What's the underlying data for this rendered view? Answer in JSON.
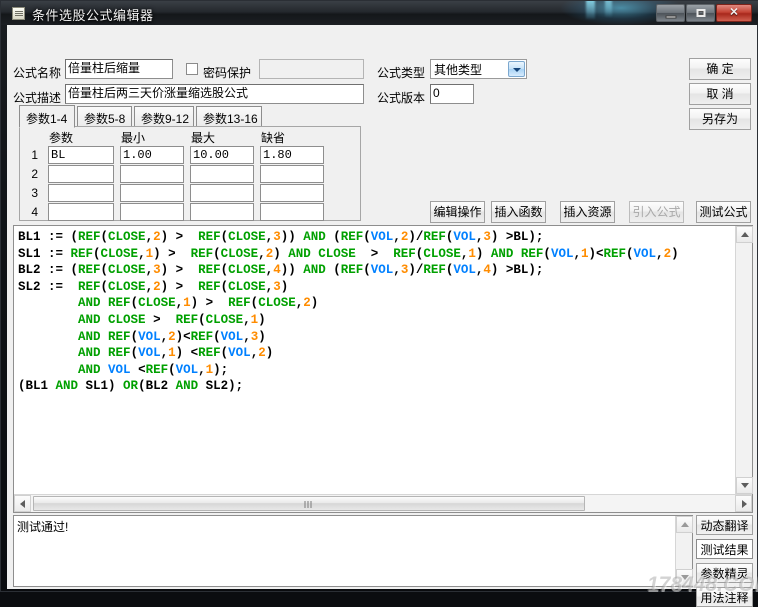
{
  "window": {
    "title": "条件选股公式编辑器",
    "icon": "document-icon",
    "buttons": {
      "minimize": "minimize-icon",
      "maximize": "maximize-icon",
      "close": "✕"
    }
  },
  "form": {
    "name_label": "公式名称",
    "name_value": "倍量柱后缩量",
    "password_label": "密码保护",
    "password_value": "",
    "password_checked": false,
    "desc_label": "公式描述",
    "desc_value": "倍量柱后两三天价涨量缩选股公式",
    "type_label": "公式类型",
    "type_value": "其他类型",
    "version_label": "公式版本",
    "version_value": "0"
  },
  "commands": {
    "ok": "确  定",
    "cancel": "取  消",
    "save_as": "另存为"
  },
  "tabs": [
    {
      "label": "参数1-4",
      "active": true
    },
    {
      "label": "参数5-8",
      "active": false
    },
    {
      "label": "参数9-12",
      "active": false
    },
    {
      "label": "参数13-16",
      "active": false
    }
  ],
  "params": {
    "headers": [
      "参数",
      "最小",
      "最大",
      "缺省"
    ],
    "rows": [
      {
        "num": "1",
        "name": "BL",
        "min": "1.00",
        "max": "10.00",
        "default": "1.80"
      },
      {
        "num": "2",
        "name": "",
        "min": "",
        "max": "",
        "default": ""
      },
      {
        "num": "3",
        "name": "",
        "min": "",
        "max": "",
        "default": ""
      },
      {
        "num": "4",
        "name": "",
        "min": "",
        "max": "",
        "default": ""
      }
    ]
  },
  "editor_toolbar": [
    {
      "label": "编辑操作",
      "enabled": true
    },
    {
      "label": "插入函数",
      "enabled": true
    },
    {
      "label": "插入资源",
      "enabled": true
    },
    {
      "label": "引入公式",
      "enabled": false
    },
    {
      "label": "测试公式",
      "enabled": true
    }
  ],
  "code": {
    "colors": {
      "function": "#00a000",
      "number": "#ff8c00",
      "variable": "#0080ff",
      "plain": "#000000"
    },
    "lines": [
      [
        {
          "t": "BL1 := (",
          "c": "p"
        },
        {
          "t": "REF",
          "c": "k"
        },
        {
          "t": "(",
          "c": "p"
        },
        {
          "t": "CLOSE",
          "c": "k"
        },
        {
          "t": ",",
          "c": "p"
        },
        {
          "t": "2",
          "c": "n"
        },
        {
          "t": ") > ",
          "c": "p"
        },
        {
          "t": " ",
          "c": "p"
        },
        {
          "t": "REF",
          "c": "k"
        },
        {
          "t": "(",
          "c": "p"
        },
        {
          "t": "CLOSE",
          "c": "k"
        },
        {
          "t": ",",
          "c": "p"
        },
        {
          "t": "3",
          "c": "n"
        },
        {
          "t": ")) ",
          "c": "p"
        },
        {
          "t": "AND",
          "c": "k"
        },
        {
          "t": " (",
          "c": "p"
        },
        {
          "t": "REF",
          "c": "k"
        },
        {
          "t": "(",
          "c": "p"
        },
        {
          "t": "VOL",
          "c": "v"
        },
        {
          "t": ",",
          "c": "p"
        },
        {
          "t": "2",
          "c": "n"
        },
        {
          "t": ")/",
          "c": "p"
        },
        {
          "t": "REF",
          "c": "k"
        },
        {
          "t": "(",
          "c": "p"
        },
        {
          "t": "VOL",
          "c": "v"
        },
        {
          "t": ",",
          "c": "p"
        },
        {
          "t": "3",
          "c": "n"
        },
        {
          "t": ") >BL);",
          "c": "p"
        }
      ],
      [
        {
          "t": "SL1 := ",
          "c": "p"
        },
        {
          "t": "REF",
          "c": "k"
        },
        {
          "t": "(",
          "c": "p"
        },
        {
          "t": "CLOSE",
          "c": "k"
        },
        {
          "t": ",",
          "c": "p"
        },
        {
          "t": "1",
          "c": "n"
        },
        {
          "t": ") > ",
          "c": "p"
        },
        {
          "t": " ",
          "c": "p"
        },
        {
          "t": "REF",
          "c": "k"
        },
        {
          "t": "(",
          "c": "p"
        },
        {
          "t": "CLOSE",
          "c": "k"
        },
        {
          "t": ",",
          "c": "p"
        },
        {
          "t": "2",
          "c": "n"
        },
        {
          "t": ") ",
          "c": "p"
        },
        {
          "t": "AND",
          "c": "k"
        },
        {
          "t": " ",
          "c": "p"
        },
        {
          "t": "CLOSE",
          "c": "k"
        },
        {
          "t": "  >  ",
          "c": "p"
        },
        {
          "t": "REF",
          "c": "k"
        },
        {
          "t": "(",
          "c": "p"
        },
        {
          "t": "CLOSE",
          "c": "k"
        },
        {
          "t": ",",
          "c": "p"
        },
        {
          "t": "1",
          "c": "n"
        },
        {
          "t": ") ",
          "c": "p"
        },
        {
          "t": "AND",
          "c": "k"
        },
        {
          "t": " ",
          "c": "p"
        },
        {
          "t": "REF",
          "c": "k"
        },
        {
          "t": "(",
          "c": "p"
        },
        {
          "t": "VOL",
          "c": "v"
        },
        {
          "t": ",",
          "c": "p"
        },
        {
          "t": "1",
          "c": "n"
        },
        {
          "t": ")<",
          "c": "p"
        },
        {
          "t": "REF",
          "c": "k"
        },
        {
          "t": "(",
          "c": "p"
        },
        {
          "t": "VOL",
          "c": "v"
        },
        {
          "t": ",",
          "c": "p"
        },
        {
          "t": "2",
          "c": "n"
        },
        {
          "t": ")",
          "c": "p"
        }
      ],
      [
        {
          "t": "BL2 := (",
          "c": "p"
        },
        {
          "t": "REF",
          "c": "k"
        },
        {
          "t": "(",
          "c": "p"
        },
        {
          "t": "CLOSE",
          "c": "k"
        },
        {
          "t": ",",
          "c": "p"
        },
        {
          "t": "3",
          "c": "n"
        },
        {
          "t": ") > ",
          "c": "p"
        },
        {
          "t": " ",
          "c": "p"
        },
        {
          "t": "REF",
          "c": "k"
        },
        {
          "t": "(",
          "c": "p"
        },
        {
          "t": "CLOSE",
          "c": "k"
        },
        {
          "t": ",",
          "c": "p"
        },
        {
          "t": "4",
          "c": "n"
        },
        {
          "t": ")) ",
          "c": "p"
        },
        {
          "t": "AND",
          "c": "k"
        },
        {
          "t": " (",
          "c": "p"
        },
        {
          "t": "REF",
          "c": "k"
        },
        {
          "t": "(",
          "c": "p"
        },
        {
          "t": "VOL",
          "c": "v"
        },
        {
          "t": ",",
          "c": "p"
        },
        {
          "t": "3",
          "c": "n"
        },
        {
          "t": ")/",
          "c": "p"
        },
        {
          "t": "REF",
          "c": "k"
        },
        {
          "t": "(",
          "c": "p"
        },
        {
          "t": "VOL",
          "c": "v"
        },
        {
          "t": ",",
          "c": "p"
        },
        {
          "t": "4",
          "c": "n"
        },
        {
          "t": ") >BL);",
          "c": "p"
        }
      ],
      [
        {
          "t": "SL2 :=  ",
          "c": "p"
        },
        {
          "t": "REF",
          "c": "k"
        },
        {
          "t": "(",
          "c": "p"
        },
        {
          "t": "CLOSE",
          "c": "k"
        },
        {
          "t": ",",
          "c": "p"
        },
        {
          "t": "2",
          "c": "n"
        },
        {
          "t": ") > ",
          "c": "p"
        },
        {
          "t": " ",
          "c": "p"
        },
        {
          "t": "REF",
          "c": "k"
        },
        {
          "t": "(",
          "c": "p"
        },
        {
          "t": "CLOSE",
          "c": "k"
        },
        {
          "t": ",",
          "c": "p"
        },
        {
          "t": "3",
          "c": "n"
        },
        {
          "t": ")",
          "c": "p"
        }
      ],
      [
        {
          "t": "        ",
          "c": "p"
        },
        {
          "t": "AND",
          "c": "k"
        },
        {
          "t": " ",
          "c": "p"
        },
        {
          "t": "REF",
          "c": "k"
        },
        {
          "t": "(",
          "c": "p"
        },
        {
          "t": "CLOSE",
          "c": "k"
        },
        {
          "t": ",",
          "c": "p"
        },
        {
          "t": "1",
          "c": "n"
        },
        {
          "t": ") > ",
          "c": "p"
        },
        {
          "t": " ",
          "c": "p"
        },
        {
          "t": "REF",
          "c": "k"
        },
        {
          "t": "(",
          "c": "p"
        },
        {
          "t": "CLOSE",
          "c": "k"
        },
        {
          "t": ",",
          "c": "p"
        },
        {
          "t": "2",
          "c": "n"
        },
        {
          "t": ")",
          "c": "p"
        }
      ],
      [
        {
          "t": "        ",
          "c": "p"
        },
        {
          "t": "AND",
          "c": "k"
        },
        {
          "t": " ",
          "c": "p"
        },
        {
          "t": "CLOSE",
          "c": "k"
        },
        {
          "t": " > ",
          "c": "p"
        },
        {
          "t": " ",
          "c": "p"
        },
        {
          "t": "REF",
          "c": "k"
        },
        {
          "t": "(",
          "c": "p"
        },
        {
          "t": "CLOSE",
          "c": "k"
        },
        {
          "t": ",",
          "c": "p"
        },
        {
          "t": "1",
          "c": "n"
        },
        {
          "t": ")",
          "c": "p"
        }
      ],
      [
        {
          "t": "        ",
          "c": "p"
        },
        {
          "t": "AND",
          "c": "k"
        },
        {
          "t": " ",
          "c": "p"
        },
        {
          "t": "REF",
          "c": "k"
        },
        {
          "t": "(",
          "c": "p"
        },
        {
          "t": "VOL",
          "c": "v"
        },
        {
          "t": ",",
          "c": "p"
        },
        {
          "t": "2",
          "c": "n"
        },
        {
          "t": ")<",
          "c": "p"
        },
        {
          "t": "REF",
          "c": "k"
        },
        {
          "t": "(",
          "c": "p"
        },
        {
          "t": "VOL",
          "c": "v"
        },
        {
          "t": ",",
          "c": "p"
        },
        {
          "t": "3",
          "c": "n"
        },
        {
          "t": ")",
          "c": "p"
        }
      ],
      [
        {
          "t": "        ",
          "c": "p"
        },
        {
          "t": "AND",
          "c": "k"
        },
        {
          "t": " ",
          "c": "p"
        },
        {
          "t": "REF",
          "c": "k"
        },
        {
          "t": "(",
          "c": "p"
        },
        {
          "t": "VOL",
          "c": "v"
        },
        {
          "t": ",",
          "c": "p"
        },
        {
          "t": "1",
          "c": "n"
        },
        {
          "t": ") <",
          "c": "p"
        },
        {
          "t": "REF",
          "c": "k"
        },
        {
          "t": "(",
          "c": "p"
        },
        {
          "t": "VOL",
          "c": "v"
        },
        {
          "t": ",",
          "c": "p"
        },
        {
          "t": "2",
          "c": "n"
        },
        {
          "t": ")",
          "c": "p"
        }
      ],
      [
        {
          "t": "        ",
          "c": "p"
        },
        {
          "t": "AND",
          "c": "k"
        },
        {
          "t": " ",
          "c": "p"
        },
        {
          "t": "VOL",
          "c": "v"
        },
        {
          "t": " <",
          "c": "p"
        },
        {
          "t": "REF",
          "c": "k"
        },
        {
          "t": "(",
          "c": "p"
        },
        {
          "t": "VOL",
          "c": "v"
        },
        {
          "t": ",",
          "c": "p"
        },
        {
          "t": "1",
          "c": "n"
        },
        {
          "t": ");",
          "c": "p"
        }
      ],
      [
        {
          "t": "(BL1 ",
          "c": "p"
        },
        {
          "t": "AND",
          "c": "k"
        },
        {
          "t": " SL1) ",
          "c": "p"
        },
        {
          "t": "OR",
          "c": "k"
        },
        {
          "t": "(BL2 ",
          "c": "p"
        },
        {
          "t": "AND",
          "c": "k"
        },
        {
          "t": " SL2);",
          "c": "p"
        }
      ]
    ]
  },
  "output": {
    "text": "测试通过!"
  },
  "side_buttons": [
    {
      "label": "动态翻译",
      "active": false
    },
    {
      "label": "测试结果",
      "active": true
    },
    {
      "label": "参数精灵",
      "active": false
    },
    {
      "label": "用法注释",
      "active": false
    }
  ],
  "watermark": "178448.COM"
}
